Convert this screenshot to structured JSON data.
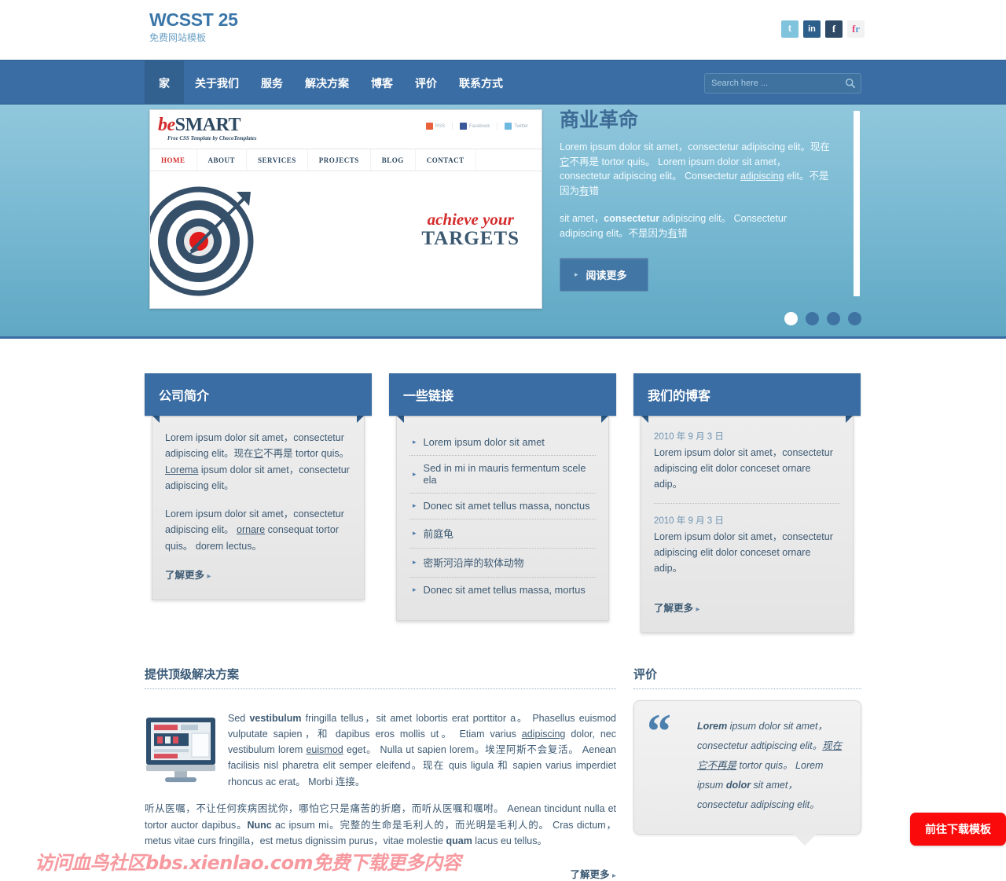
{
  "header": {
    "logo_title": "WCSST 25",
    "logo_sub": "免费网站模板",
    "social": [
      {
        "name": "twitter",
        "glyph": "t"
      },
      {
        "name": "linkedin",
        "glyph": "in"
      },
      {
        "name": "facebook",
        "glyph": "f"
      },
      {
        "name": "flickr",
        "glyph": "f",
        "glyph2": "r"
      }
    ]
  },
  "nav": {
    "items": [
      {
        "label": "家",
        "active": true
      },
      {
        "label": "关于我们",
        "active": false
      },
      {
        "label": "服务",
        "active": false
      },
      {
        "label": "解决方案",
        "active": false
      },
      {
        "label": "博客",
        "active": false
      },
      {
        "label": "评价",
        "active": false
      },
      {
        "label": "联系方式",
        "active": false
      }
    ],
    "search_placeholder": "Search here ...",
    "search_value": ""
  },
  "hero": {
    "title": "商业革命",
    "paragraph1_a": "Lorem ipsum dolor sit amet，consectetur adipiscing elit。现在",
    "paragraph1_u1": "它",
    "paragraph1_b": "不再是 tortor quis。 Lorem ipsum dolor sit amet，consectetur adipiscing elit。 Consectetur ",
    "paragraph1_u2": "adipiscing",
    "paragraph1_c": " elit。不是因为",
    "paragraph1_u3": "有",
    "paragraph1_d": "错",
    "paragraph2_a": "sit amet，",
    "paragraph2_b": "consectetur",
    "paragraph2_c": " adipiscing elit。 Consectetur adipiscing elit。不是因为",
    "paragraph2_u": "有",
    "paragraph2_d": "错",
    "button_label": "阅读更多",
    "dots": [
      true,
      false,
      false,
      false
    ],
    "slide": {
      "logo_italic": "be",
      "logo_rest": "SMART",
      "tagline": "Free CSS Template by ChocoTemplates",
      "social": [
        "RSS",
        "Facebook",
        "Twitter"
      ],
      "nav": [
        "HOME",
        "ABOUT",
        "SERVICES",
        "PROJECTS",
        "BLOG",
        "CONTACT"
      ],
      "headline1": "achieve your",
      "headline2": "TARGETS"
    }
  },
  "boxes": [
    {
      "title": "公司简介",
      "p1_a": "Lorem ipsum dolor sit amet，consectetur adipiscing elit。现在",
      "p1_u1": "它",
      "p1_b": "不再是 tortor quis。 ",
      "p1_u2": "Lorema",
      "p1_c": " ipsum dolor sit amet，consectetur adipiscing elit。",
      "p2_a": "Lorem ipsum dolor sit amet，consectetur adipiscing elit。 ",
      "p2_u": "ornare",
      "p2_b": " consequat tortor quis。 dorem lectus。",
      "more": "了解更多"
    }
  ],
  "links_box": {
    "title": "一些链接",
    "items": [
      "Lorem ipsum dolor sit amet",
      "Sed in mi in mauris fermentum scele ela",
      "Donec sit amet tellus massa, nonctus",
      "前庭龟",
      "密斯河沿岸的软体动物",
      "Donec sit amet tellus massa, mortus"
    ]
  },
  "blog_box": {
    "title": "我们的博客",
    "posts": [
      {
        "date": "2010 年 9 月 3 日",
        "text": "Lorem ipsum dolor sit amet，consectetur adipiscing elit dolor conceset ornare adip。"
      },
      {
        "date": "2010 年 9 月 3 日",
        "text": "Lorem ipsum dolor sit amet，consectetur adipiscing elit dolor conceset ornare adip。"
      }
    ],
    "more": "了解更多"
  },
  "solutions": {
    "title": "提供顶级解决方案",
    "p_a": "Sed ",
    "p_b1": "vestibulum",
    "p_c": " fringilla tellus，sit amet lobortis erat porttitor a。 Phasellus euismod vulputate sapien，和 dapibus eros mollis ut。 Etiam varius ",
    "p_u1": "adipiscing",
    "p_d": " dolor, nec vestibulum lorem ",
    "p_u2": "euismod",
    "p_e": " eget。 Nulla ut sapien lorem。埃涅阿斯不会复活。 Aenean facilisis nisl pharetra elit semper eleifend。现在 quis ligula 和 sapien varius imperdiet rhoncus ac erat。 Morbi 连接。",
    "p2_a": "听从医嘱，不让任何疾病困扰你，哪怕它只是痛苦的折磨，而听从医嘱和嘱咐。 Aenean tincidunt nulla et tortor auctor dapibus。",
    "p2_b1": "Nunc",
    "p2_c": " ac ipsum mi。完整的生命是毛利人的，而光明是毛利人的。 Cras dictum，metus vitae curs fringilla，est metus dignissim purus，vitae molestie ",
    "p2_b2": "quam",
    "p2_d": " lacus eu tellus。",
    "more": "了解更多"
  },
  "testimonial": {
    "title": "评价",
    "q_b1": "Lorem",
    "q_a": " ipsum dolor sit amet，consectetur adtipiscing elit。",
    "q_u": "现在它不再是",
    "q_b": " tortor quis。 Lorem ipsum ",
    "q_b2": "dolor",
    "q_c": " sit amet，consectetur adipiscing elit。"
  },
  "overlays": {
    "watermark": "访问血鸟社区bbs.xienlao.com免费下载更多内容",
    "download_button": "前往下载模板"
  }
}
